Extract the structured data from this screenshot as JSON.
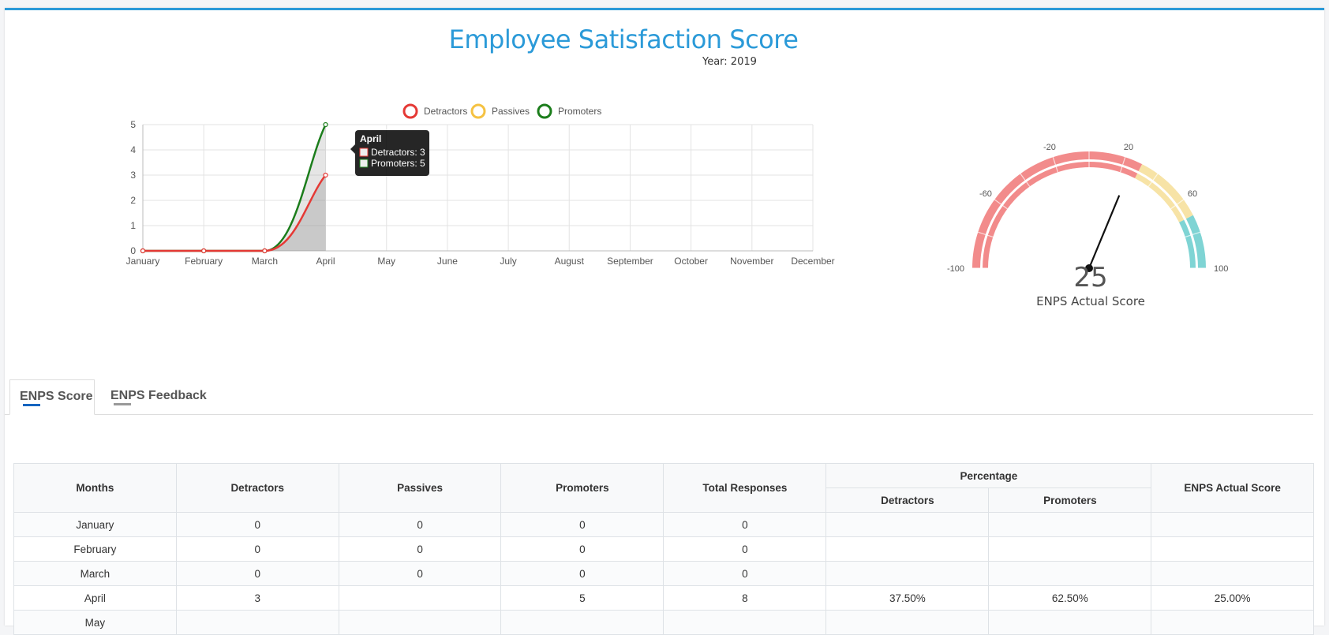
{
  "header": {
    "title": "Employee Satisfaction Score",
    "year": "Year: 2019"
  },
  "colors": {
    "accent": "#2b9ad8",
    "detractors": "#e53935",
    "passives": "#f5c242",
    "promoters": "#1b7d1b"
  },
  "chart_data": {
    "type": "line",
    "categories": [
      "January",
      "February",
      "March",
      "April",
      "May",
      "June",
      "July",
      "August",
      "September",
      "October",
      "November",
      "December"
    ],
    "series": [
      {
        "name": "Detractors",
        "values": [
          0,
          0,
          0,
          3
        ]
      },
      {
        "name": "Passives",
        "values": []
      },
      {
        "name": "Promoters",
        "values": [
          0,
          0,
          0,
          5
        ]
      }
    ],
    "ylim": [
      0,
      5
    ],
    "yticks": [
      "0",
      "1",
      "2",
      "3",
      "4",
      "5"
    ],
    "grid": true,
    "legend": "top",
    "tooltip": {
      "title": "April",
      "lines": [
        "Detractors: 3",
        "Promoters: 5"
      ]
    }
  },
  "gauge": {
    "min": -100,
    "max": 100,
    "value": 25,
    "ticks": [
      "-100",
      "-60",
      "-20",
      "20",
      "60",
      "100"
    ],
    "bands": [
      {
        "from": -100,
        "to": 30,
        "color": "#f28b8b"
      },
      {
        "from": 30,
        "to": 70,
        "color": "#f7e3a6"
      },
      {
        "from": 70,
        "to": 100,
        "color": "#7fd4d4"
      }
    ],
    "score": "25",
    "label": "ENPS Actual Score"
  },
  "tabs": [
    {
      "label": "ENPS Score",
      "active": true,
      "color": "#1565c0"
    },
    {
      "label": "ENPS Feedback",
      "active": false,
      "color": "#999999"
    }
  ],
  "table": {
    "headers": {
      "months": "Months",
      "detractors": "Detractors",
      "passives": "Passives",
      "promoters": "Promoters",
      "total": "Total Responses",
      "percentage": "Percentage",
      "pct_detractors": "Detractors",
      "pct_promoters": "Promoters",
      "enps": "ENPS Actual Score"
    },
    "rows": [
      [
        "January",
        "0",
        "0",
        "0",
        "0",
        "",
        "",
        ""
      ],
      [
        "February",
        "0",
        "0",
        "0",
        "0",
        "",
        "",
        ""
      ],
      [
        "March",
        "0",
        "0",
        "0",
        "0",
        "",
        "",
        ""
      ],
      [
        "April",
        "3",
        "",
        "5",
        "8",
        "37.50%",
        "62.50%",
        "25.00%"
      ],
      [
        "May",
        "",
        "",
        "",
        "",
        "",
        "",
        ""
      ]
    ]
  }
}
